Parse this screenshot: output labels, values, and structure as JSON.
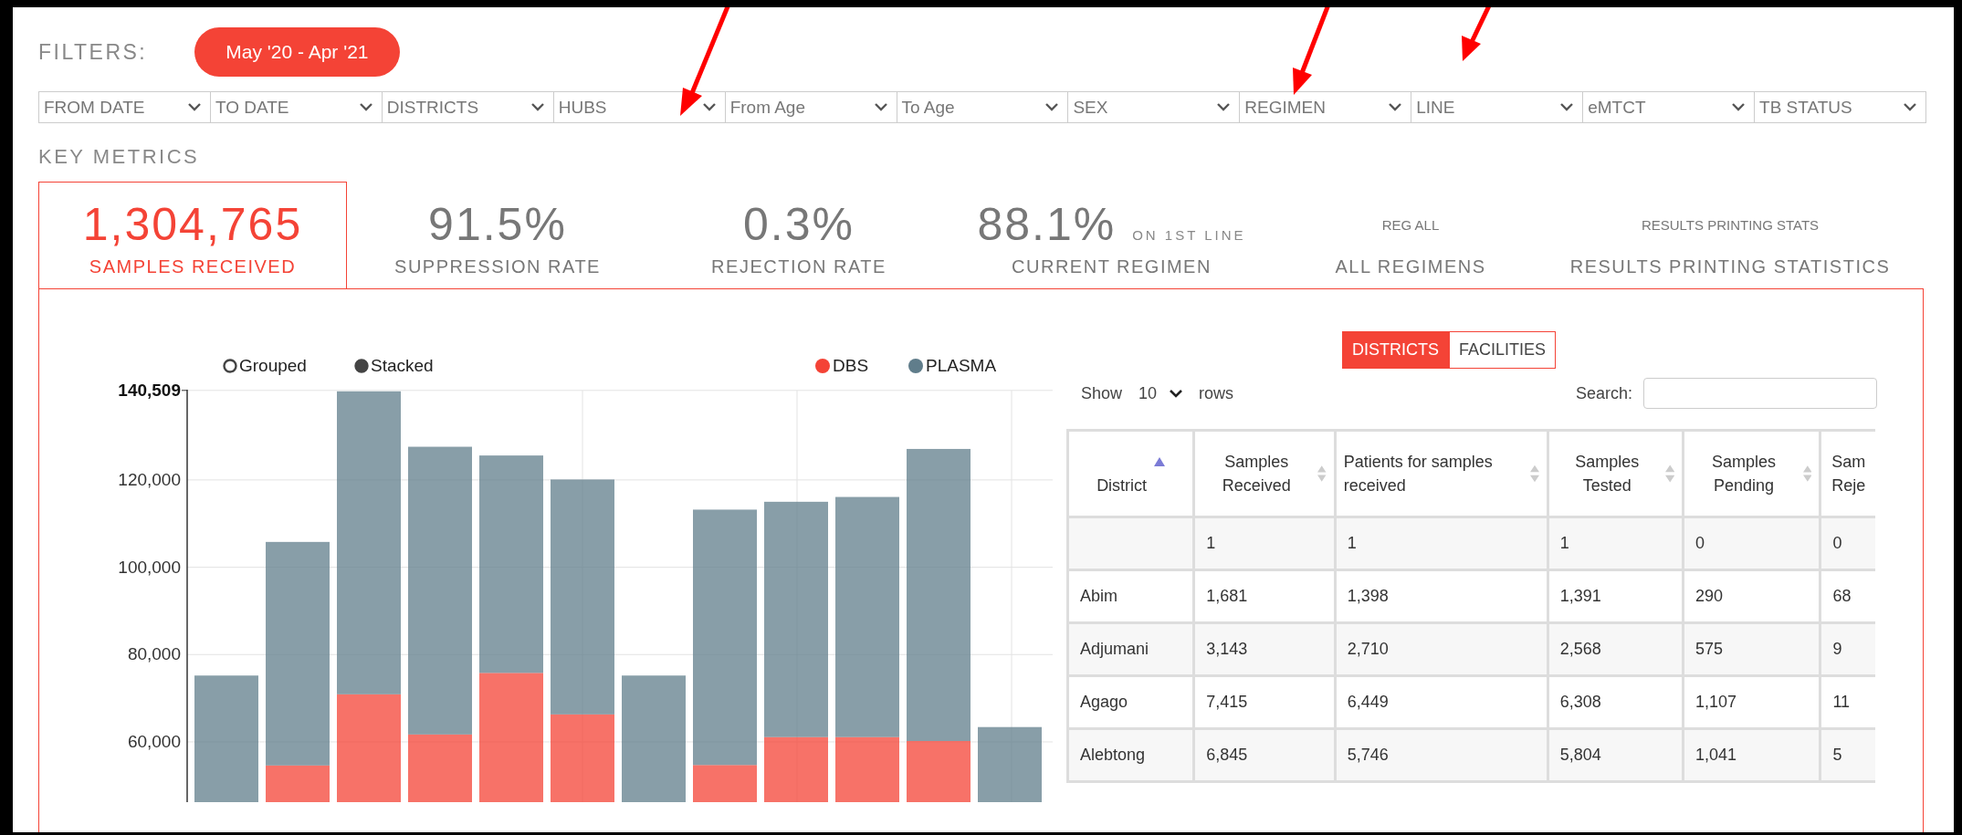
{
  "filters": {
    "title": "FILTERS:",
    "period": "May '20 - Apr '21",
    "selects": [
      {
        "label": "FROM DATE"
      },
      {
        "label": "TO DATE"
      },
      {
        "label": "DISTRICTS"
      },
      {
        "label": "HUBS"
      },
      {
        "label": "From Age"
      },
      {
        "label": "To Age"
      },
      {
        "label": "SEX"
      },
      {
        "label": "REGIMEN"
      },
      {
        "label": "LINE"
      },
      {
        "label": "eMTCT"
      },
      {
        "label": "TB STATUS"
      }
    ]
  },
  "key_metrics": {
    "title": "KEY METRICS",
    "items": [
      {
        "kind": "big",
        "value": "1,304,765",
        "label": "SAMPLES RECEIVED",
        "selected": true
      },
      {
        "kind": "big",
        "value": "91.5%",
        "label": "SUPPRESSION RATE",
        "selected": false
      },
      {
        "kind": "big",
        "value": "0.3%",
        "label": "REJECTION RATE",
        "selected": false
      },
      {
        "kind": "big",
        "value": "88.1%",
        "note": "ON 1ST LINE",
        "label": "CURRENT REGIMEN",
        "selected": false
      },
      {
        "kind": "small",
        "value": "REG ALL",
        "label": "ALL REGIMENS",
        "selected": false
      },
      {
        "kind": "small",
        "value": "RESULTS PRINTING STATS",
        "label": "RESULTS PRINTING STATISTICS",
        "selected": false
      }
    ]
  },
  "chart": {
    "modes": [
      {
        "label": "Grouped",
        "selected": false
      },
      {
        "label": "Stacked",
        "selected": true
      }
    ],
    "chart_data": {
      "type": "bar",
      "stacked": true,
      "grid": true,
      "legend": true,
      "ylim": [
        46200,
        140509
      ],
      "yticks": [
        {
          "value": 60000,
          "label": "60,000"
        },
        {
          "value": 80000,
          "label": "80,000"
        },
        {
          "value": 100000,
          "label": "100,000"
        },
        {
          "value": 120000,
          "label": "120,000"
        },
        {
          "value": 140509,
          "label": "140,509"
        }
      ],
      "series": [
        {
          "name": "DBS",
          "color": "#f44336",
          "values": [
            null,
            54600,
            70900,
            61700,
            75800,
            66300,
            null,
            54700,
            61100,
            61100,
            60200,
            null
          ]
        },
        {
          "name": "PLASMA",
          "color": "#607d8b",
          "values": [
            75200,
            51200,
            69400,
            65900,
            49800,
            53800,
            75200,
            58500,
            53900,
            55000,
            66900,
            63400
          ]
        }
      ]
    }
  },
  "table_panel": {
    "tabs": [
      {
        "label": "DISTRICTS",
        "selected": true
      },
      {
        "label": "FACILITIES",
        "selected": false
      }
    ],
    "show_label": "Show",
    "page_size": "10",
    "rows_label": "rows",
    "search_label": "Search:",
    "columns": [
      {
        "label": "District",
        "sorted": true
      },
      {
        "label": "Samples Received",
        "sorted": false
      },
      {
        "label": "Patients for samples received",
        "sorted": false
      },
      {
        "label": "Samples Tested",
        "sorted": false
      },
      {
        "label": "Samples Pending",
        "sorted": false
      },
      {
        "label": "Sam Reje"
      }
    ],
    "rows": [
      {
        "values": [
          "1",
          "1",
          "1",
          "0",
          "0"
        ]
      },
      {
        "district": "Abim",
        "values": [
          "1,681",
          "1,398",
          "1,391",
          "290",
          "68"
        ]
      },
      {
        "district": "Adjumani",
        "values": [
          "3,143",
          "2,710",
          "2,568",
          "575",
          "9"
        ]
      },
      {
        "district": "Agago",
        "values": [
          "7,415",
          "6,449",
          "6,308",
          "1,107",
          "11"
        ]
      },
      {
        "district": "Alebtong",
        "values": [
          "6,845",
          "5,746",
          "5,804",
          "1,041",
          "5"
        ]
      }
    ]
  }
}
